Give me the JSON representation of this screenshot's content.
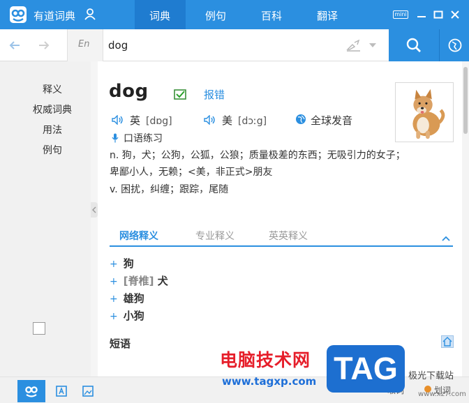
{
  "app": {
    "title": "有道词典"
  },
  "nav": {
    "tabs": [
      "词典",
      "例句",
      "百科",
      "翻译"
    ],
    "mini": "mini"
  },
  "toolbar": {
    "lang": "En",
    "query": "dog"
  },
  "sidebar": {
    "items": [
      "释义",
      "权威词典",
      "用法",
      "例句"
    ]
  },
  "entry": {
    "word": "dog",
    "report": "报错",
    "uk_label": "英",
    "uk_phonetic": "[dɒg]",
    "us_label": "美",
    "us_phonetic": "[dɔːg]",
    "global": "全球发音",
    "oral": "口语练习",
    "defs": [
      "n. 狗，犬；公狗，公狐，公狼；质量极差的东西；无吸引力的女子；",
      "卑鄙小人，无赖；<美，非正式>朋友",
      "v. 困扰，纠缠；跟踪，尾随"
    ]
  },
  "tabs2": [
    "网络释义",
    "专业释义",
    "英英释义"
  ],
  "web_defs": {
    "items": [
      "狗",
      "犬",
      "雄狗",
      "小狗"
    ],
    "tag": "[脊椎]"
  },
  "phrases": {
    "heading": "短语"
  },
  "status": {
    "left": "取词",
    "right": "划词"
  },
  "watermark": {
    "line1": "电脑技术网",
    "line2": "www.tagxp.com",
    "tag": "TAG",
    "line3": "极光下载站",
    "line4": "www.xz7.com"
  },
  "colors": {
    "accent": "#2b8fe0",
    "watermark_red": "#e61e2a"
  }
}
